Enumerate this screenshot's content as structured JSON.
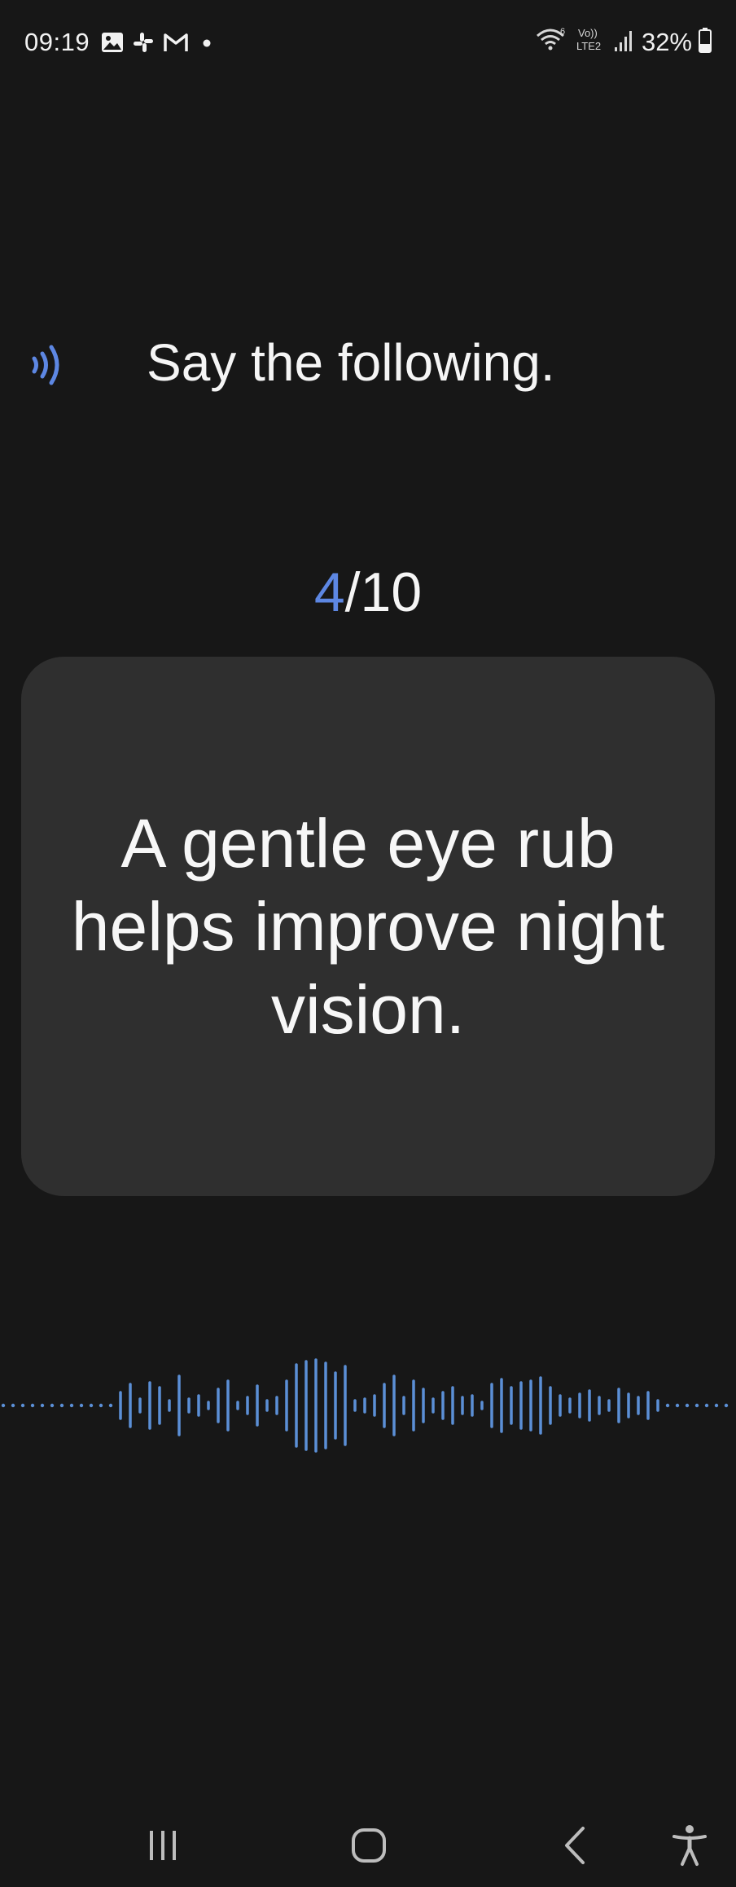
{
  "status_bar": {
    "time": "09:19",
    "battery_percent": "32%",
    "network_label_top": "Vo))",
    "network_label_bottom": "LTE2",
    "wifi_label": "6",
    "left_icons": [
      "gallery-icon",
      "slack-icon",
      "gmail-icon",
      "dot-icon"
    ],
    "right_icons": [
      "wifi-icon",
      "volte-icon",
      "signal-icon",
      "battery-icon"
    ]
  },
  "prompt": {
    "title": "Say the following.",
    "speaker_icon": "speaker-icon"
  },
  "counter": {
    "current": "4",
    "total": "/10"
  },
  "card": {
    "phrase": "A gentle eye rub helps improve night vision."
  },
  "waveform": {
    "color": "#5b8fd6"
  },
  "nav_bar": {
    "icons": [
      "recent-apps-icon",
      "home-icon",
      "back-icon",
      "accessibility-icon"
    ]
  },
  "colors": {
    "background": "#171717",
    "card": "#2f2f2f",
    "accent": "#5d87e3"
  }
}
